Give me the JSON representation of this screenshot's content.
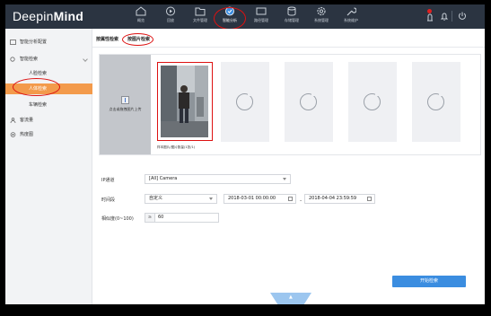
{
  "app": {
    "logo_light": "Deepin",
    "logo_bold": "Mind"
  },
  "nav": [
    {
      "label": "概览",
      "icon": "home-icon"
    },
    {
      "label": "回放",
      "icon": "playback-icon"
    },
    {
      "label": "文件管理",
      "icon": "folder-icon"
    },
    {
      "label": "智能分析",
      "icon": "analysis-icon",
      "active": true
    },
    {
      "label": "路径管理",
      "icon": "camera-icon"
    },
    {
      "label": "存储管理",
      "icon": "database-icon"
    },
    {
      "label": "系统管理",
      "icon": "gear-icon"
    },
    {
      "label": "系统维护",
      "icon": "wrench-icon"
    }
  ],
  "sidebar": {
    "items": [
      {
        "label": "智能分析配置",
        "icon": "config-icon"
      },
      {
        "label": "智能检索",
        "icon": "search-icon"
      },
      {
        "label": "人脸检索"
      },
      {
        "label": "人体检索",
        "selected": true
      },
      {
        "label": "车辆检索"
      },
      {
        "label": "客流量",
        "icon": "person-icon"
      },
      {
        "label": "热度图",
        "icon": "heatmap-icon"
      }
    ]
  },
  "tabs": [
    {
      "label": "按属性检索"
    },
    {
      "label": "按图片检索",
      "active": true
    }
  ],
  "picture_panel": {
    "upload_label": "点击或拖拽图片上传",
    "photo_caption": "样本图片/图片数量(1张/1)"
  },
  "form": {
    "ip_channel": {
      "label": "IP通道",
      "value": "[All] Camera"
    },
    "time_range": {
      "label": "时间段",
      "mode": "自定义",
      "start": "2018-03-01 00:00:00",
      "end": "2018-04-04 23:59:59",
      "separator": "-"
    },
    "similarity": {
      "label": "相似度(0~100)",
      "prefix": "≥",
      "value": "60"
    }
  },
  "search_button": {
    "label": "开始检索"
  },
  "colors": {
    "topbar": "#2b3441",
    "sidebar_selected": "#f39a4b",
    "button": "#3b8de0",
    "annotation": "#dd1111"
  }
}
